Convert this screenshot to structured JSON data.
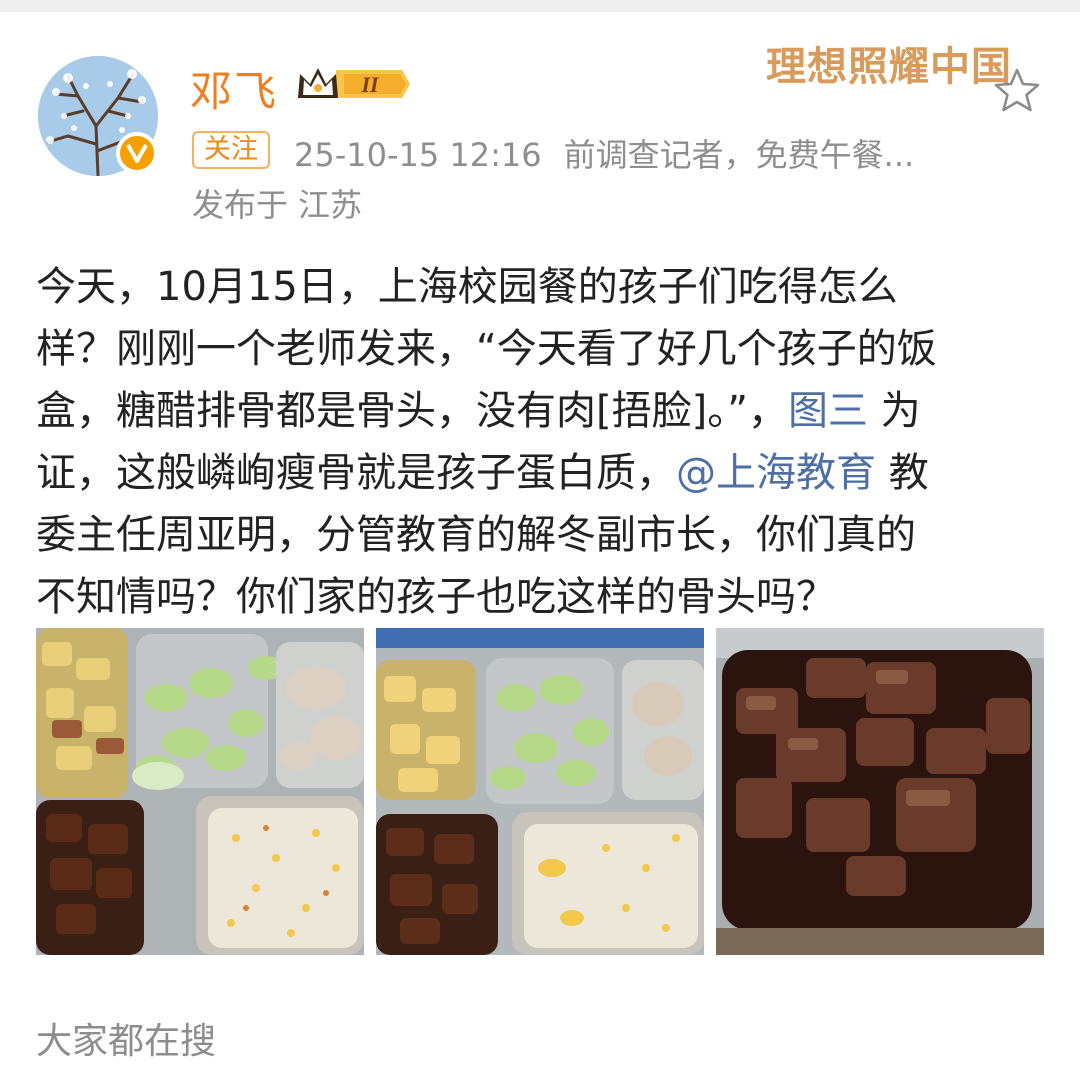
{
  "author": {
    "name": "邓飞",
    "level": "II",
    "follow_label": "关注",
    "timestamp": "25-10-15 12:16",
    "description": "前调查记者，免费午餐...",
    "location_prefix": "发布于",
    "location": "江苏"
  },
  "brand_slogan": "理想照耀中国",
  "post": {
    "line1": "今天，10月15日，上海校园餐的孩子们吃得怎么",
    "line2": "样？刚刚一个老师发来，“今天看了好几个孩子的饭",
    "line3_a": "盒，糖醋排骨都是骨头，没有肉[捂脸]。”，",
    "line3_link": "图三",
    "line3_b": "为",
    "line4_a": "证，这般嶙峋瘦骨就是孩子蛋白质，",
    "line4_mention": "@上海教育",
    "line4_b": "教",
    "line5": "委主任周亚明，分管教育的解冬副市长，你们真的",
    "line6": "不知情吗？你们家的孩子也吃这样的骨头吗？"
  },
  "trending_label": "大家都在搜",
  "icons": {
    "verified": "verified-badge-icon",
    "crown": "crown-icon",
    "favorite": "star-icon"
  },
  "colors": {
    "username": "#f07d1e",
    "link": "#4e6fa5",
    "secondary_text": "#8e8e8e"
  }
}
